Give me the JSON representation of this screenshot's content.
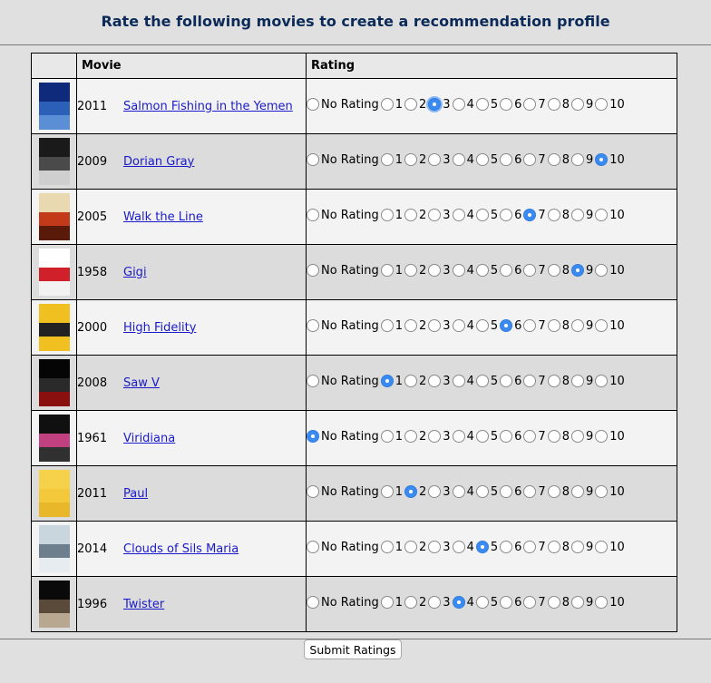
{
  "page": {
    "title": "Rate the following movies to create a recommendation profile"
  },
  "table": {
    "headers": {
      "poster": "",
      "movie": "Movie",
      "rating": "Rating"
    },
    "rating_options": [
      "No Rating",
      "1",
      "2",
      "3",
      "4",
      "5",
      "6",
      "7",
      "8",
      "9",
      "10"
    ],
    "rows": [
      {
        "year": "2011",
        "title": "Salmon Fishing in the Yemen",
        "selected": "3",
        "poster_colors": [
          "#0f2a7a",
          "#2b5fb8",
          "#5a8fd6"
        ]
      },
      {
        "year": "2009",
        "title": "Dorian Gray",
        "selected": "10",
        "poster_colors": [
          "#1a1a1a",
          "#4a4a4a",
          "#cfcfcf"
        ]
      },
      {
        "year": "2005",
        "title": "Walk the Line",
        "selected": "7",
        "poster_colors": [
          "#e8d9b0",
          "#c23a1a",
          "#5a1a0a"
        ]
      },
      {
        "year": "1958",
        "title": "Gigi",
        "selected": "9",
        "poster_colors": [
          "#ffffff",
          "#d0202a",
          "#f2f2f2"
        ]
      },
      {
        "year": "2000",
        "title": "High Fidelity",
        "selected": "6",
        "poster_colors": [
          "#f0c020",
          "#222222",
          "#f0c020"
        ]
      },
      {
        "year": "2008",
        "title": "Saw V",
        "selected": "1",
        "poster_colors": [
          "#050505",
          "#2a2a2a",
          "#8a1010"
        ]
      },
      {
        "year": "1961",
        "title": "Viridiana",
        "selected": "No Rating",
        "poster_colors": [
          "#101010",
          "#c04080",
          "#303030"
        ]
      },
      {
        "year": "2011",
        "title": "Paul",
        "selected": "2",
        "poster_colors": [
          "#f6d24a",
          "#f3c83a",
          "#e9b82a"
        ]
      },
      {
        "year": "2014",
        "title": "Clouds of Sils Maria",
        "selected": "5",
        "poster_colors": [
          "#c9d6de",
          "#6d7f8c",
          "#e6ecef"
        ]
      },
      {
        "year": "1996",
        "title": "Twister",
        "selected": "4",
        "poster_colors": [
          "#0a0a0a",
          "#5a4a3a",
          "#b8a890"
        ]
      }
    ]
  },
  "submit_label": "Submit Ratings",
  "colors": {
    "accent": "#3b8af0",
    "title": "#0b2a57",
    "link": "#1a1acc"
  },
  "focused": {
    "row": 0,
    "option": "3"
  }
}
